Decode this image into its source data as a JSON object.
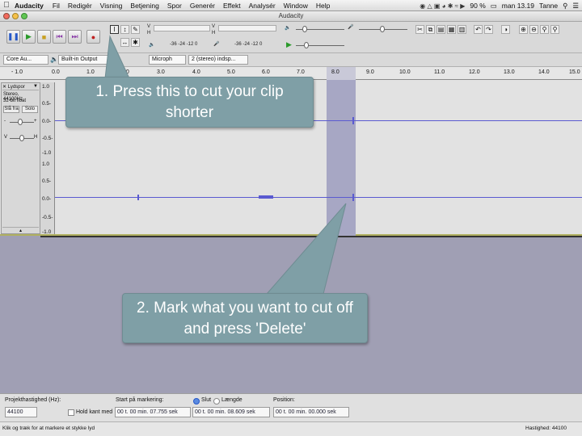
{
  "menubar": {
    "app_name": "Audacity",
    "items": [
      "Fil",
      "Redigér",
      "Visning",
      "Betjening",
      "Spor",
      "Generér",
      "Effekt",
      "Analysér",
      "Window",
      "Help"
    ],
    "battery": "90 %",
    "clock": "man 13.19",
    "user": "Tanne"
  },
  "window": {
    "title": "Audacity"
  },
  "toolbar": {
    "meter_left_scale": "-36  -24  -12   0",
    "meter_right_scale": "-36  -24  -12   0",
    "meter_ch_top": "V",
    "meter_ch_bottom": "H"
  },
  "devices": {
    "host": "Core Au...",
    "output": "Built-in Output",
    "input": "Microph",
    "channels": "2 (stereo) indsp..."
  },
  "ruler": {
    "ticks": [
      "- 1.0",
      "0.0",
      "1.0",
      "2.0",
      "3.0",
      "4.0",
      "5.0",
      "6.0",
      "7.0",
      "8.0",
      "9.0",
      "10.0",
      "11.0",
      "12.0",
      "13.0",
      "14.0",
      "15.0"
    ]
  },
  "track": {
    "name": "Lydspor",
    "info1": "Stereo, 44100Hz",
    "info2": "32-bit float",
    "mute": "Slå fra",
    "solo": "Solo",
    "vscale": [
      "1.0",
      "0.5-",
      "0.0-",
      "-0.5-",
      "-1.0"
    ]
  },
  "callouts": {
    "one": "1.   Press this to cut your clip shorter",
    "two": "2. Mark what you want to cut off and press 'Delete'"
  },
  "selectionbar": {
    "rate_label": "Projekthastighed (Hz):",
    "rate_value": "44100",
    "snap_label": "Hold kant med",
    "start_label": "Start på markering:",
    "end_radio": "Slut",
    "length_radio": "Længde",
    "position_label": "Position:",
    "start_value": "00 t. 00 min. 07.755 sek",
    "end_value": "00 t. 00 min. 08.609 sek",
    "position_value": "00 t. 00 min. 00.000 sek"
  },
  "status": {
    "hint": "Klik og træk for at markere et stykke lyd",
    "rate": "Hastighed: 44100"
  },
  "colors": {
    "callout": "#7f9fa6",
    "selection": "#a7a7c4",
    "waveform": "#5a5ad0",
    "empty_area": "#a09fb4"
  }
}
